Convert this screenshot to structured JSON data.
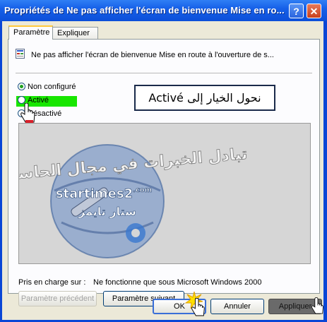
{
  "window": {
    "title": "Propriétés de Ne pas afficher l'écran de bienvenue Mise en ro...",
    "help_label": "?",
    "close_label": "✕"
  },
  "tabs": [
    {
      "label": "Paramètre",
      "active": true
    },
    {
      "label": "Expliquer",
      "active": false
    }
  ],
  "policy": {
    "icon": "policy-setting-icon",
    "text": "Ne pas afficher l'écran de bienvenue Mise en route à l'ouverture de s..."
  },
  "options": [
    {
      "label": "Non configuré",
      "selected": true
    },
    {
      "label": "Activé",
      "selected": false,
      "highlight": "#18e600"
    },
    {
      "label": "Désactivé",
      "selected": false
    }
  ],
  "callout": {
    "text": "نحول الخيار إلى Activé"
  },
  "watermark": {
    "arabic_line": "تبادل الخبرات في مجال الحاسب",
    "brand": "startimes2",
    "brand_suffix": ".com",
    "brand_arabic": "ستار تايمز"
  },
  "support": {
    "label": "Pris en charge sur :",
    "value": "Ne fonctionne que sous Microsoft Windows 2000"
  },
  "nav_buttons": {
    "previous": "Paramètre précédent",
    "next": "Paramètre suivant"
  },
  "dialog_buttons": {
    "ok": "OK",
    "cancel": "Annuler",
    "apply": "Appliquer"
  },
  "colors": {
    "title_bar": "#0c4fd9",
    "client": "#ece9d8",
    "highlight": "#18e600"
  }
}
